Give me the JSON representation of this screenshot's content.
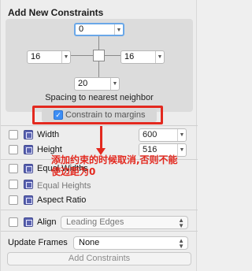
{
  "header": {
    "title": "Add New Constraints"
  },
  "spacing": {
    "top": "0",
    "left": "16",
    "right": "16",
    "bottom": "20",
    "label": "Spacing to nearest neighbor"
  },
  "constrain_to_margins": {
    "label": "Constrain to margins",
    "checked": true
  },
  "size": {
    "width_label": "Width",
    "width_value": "600",
    "height_label": "Height",
    "height_value": "516"
  },
  "options": {
    "equal_widths": "Equal Widths",
    "equal_heights": "Equal Heights",
    "aspect_ratio": "Aspect Ratio"
  },
  "align": {
    "label": "Align",
    "value": "Leading Edges"
  },
  "update_frames": {
    "label": "Update Frames",
    "value": "None"
  },
  "add_button": "Add Constraints",
  "annotation": "添加约束的时候取消,否则不能使边距为0",
  "accent_colors": {
    "annotation_red": "#e3291f",
    "checkbox_blue": "#3d8ef5"
  }
}
